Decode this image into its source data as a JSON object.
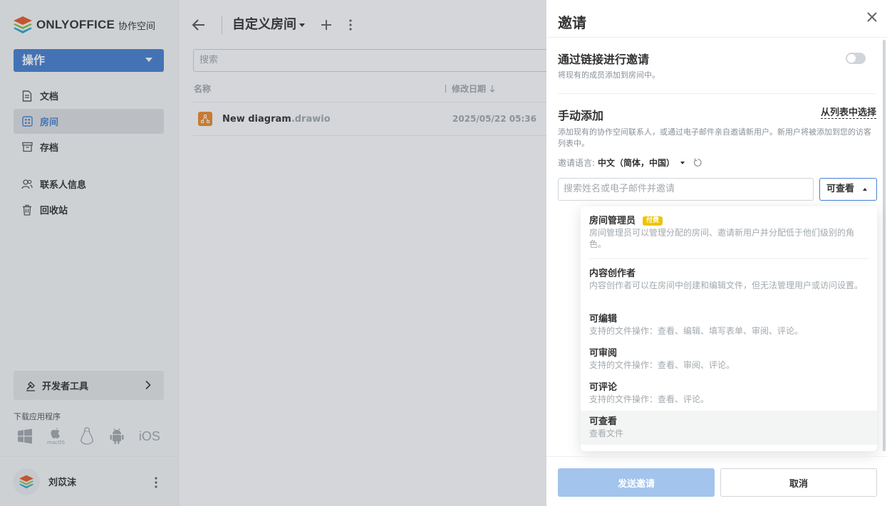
{
  "app": {
    "brand": "ONLYOFFICE",
    "brand_suffix": "协作空间",
    "accent_color": "#4781d1"
  },
  "sidebar": {
    "action_label": "操作",
    "items": [
      {
        "label": "文档",
        "icon": "document-icon",
        "active": false
      },
      {
        "label": "房间",
        "icon": "rooms-icon",
        "active": true
      },
      {
        "label": "存档",
        "icon": "archive-icon",
        "active": false
      },
      {
        "label": "联系人信息",
        "icon": "contacts-icon",
        "active": false
      },
      {
        "label": "回收站",
        "icon": "trash-icon",
        "active": false
      }
    ],
    "dev_tools_label": "开发者工具",
    "download_label": "下载应用程序",
    "download_icons": [
      "windows-icon",
      "macos-icon",
      "linux-icon",
      "android-icon",
      "ios-icon"
    ],
    "macos_text": "macOS",
    "ios_text": "iOS",
    "user_name": "刘苡沫"
  },
  "main": {
    "room_title": "自定义房间",
    "search_placeholder": "搜索",
    "columns": {
      "name": "名称",
      "modified": "修改日期"
    },
    "files": [
      {
        "name": "New diagram",
        "ext": ".drawio",
        "modified": "2025/05/22 05:36",
        "icon": "diagram-file-icon"
      }
    ]
  },
  "invite_panel": {
    "title": "邀请",
    "link_section": {
      "title": "通过链接进行邀请",
      "desc": "将现有的成员添加到房间中。",
      "toggle_on": false
    },
    "manual_section": {
      "title": "手动添加",
      "from_list": "从列表中选择",
      "desc": "添加现有的协作空间联系人，或通过电子邮件亲自邀请新用户。新用户将被添加到您的访客列表中。",
      "lang_label": "邀请语言:",
      "lang_value": "中文（简体，中国）",
      "input_placeholder": "搜索姓名或电子邮件并邀请",
      "role_selected": "可查看"
    },
    "roles": [
      {
        "title": "房间管理员",
        "badge": "付费",
        "desc": "房间管理员可以管理分配的房间、邀请新用户并分配低于他们级别的角色。",
        "selected": false
      },
      {
        "title": "内容创作者",
        "desc": "内容创作者可以在房间中创建和编辑文件，但无法管理用户或访问设置。",
        "selected": false
      },
      {
        "title": "可编辑",
        "desc": "支持的文件操作：查看、编辑、填写表单、审阅、评论。",
        "selected": false
      },
      {
        "title": "可审阅",
        "desc": "支持的文件操作：查看、审阅、评论。",
        "selected": false
      },
      {
        "title": "可评论",
        "desc": "支持的文件操作：查看、评论。",
        "selected": false
      },
      {
        "title": "可查看",
        "desc": "查看文件",
        "selected": true
      }
    ],
    "send_label": "发送邀请",
    "cancel_label": "取消"
  }
}
